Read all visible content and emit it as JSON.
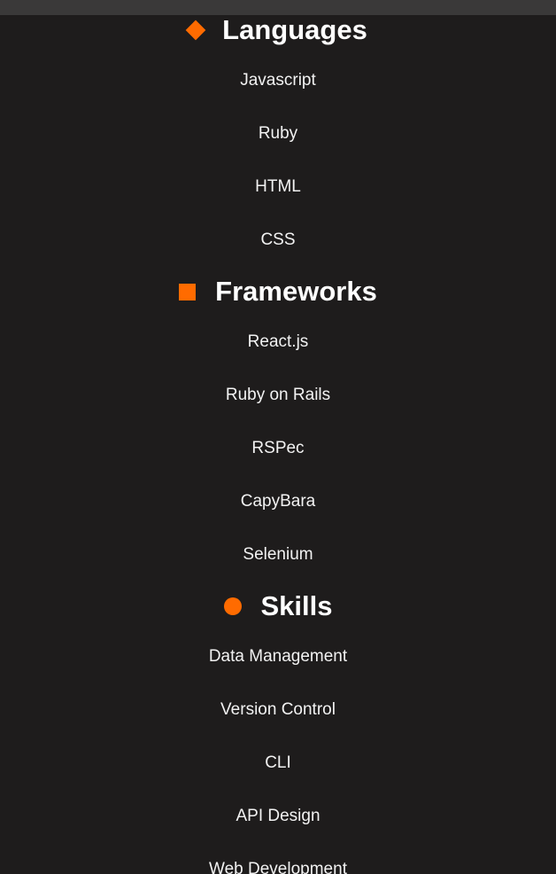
{
  "sections": [
    {
      "title": "Languages",
      "icon": "diamond-icon",
      "items": [
        "Javascript",
        "Ruby",
        "HTML",
        "CSS"
      ]
    },
    {
      "title": "Frameworks",
      "icon": "square-icon",
      "items": [
        "React.js",
        "Ruby on Rails",
        "RSPec",
        "CapyBara",
        "Selenium"
      ]
    },
    {
      "title": "Skills",
      "icon": "circle-icon",
      "items": [
        "Data Management",
        "Version Control",
        "CLI",
        "API Design",
        "Web Development"
      ]
    }
  ],
  "colors": {
    "accent": "#ff6b00",
    "background": "#1e1c1c",
    "topbar": "#3a3939",
    "text": "#ffffff"
  }
}
